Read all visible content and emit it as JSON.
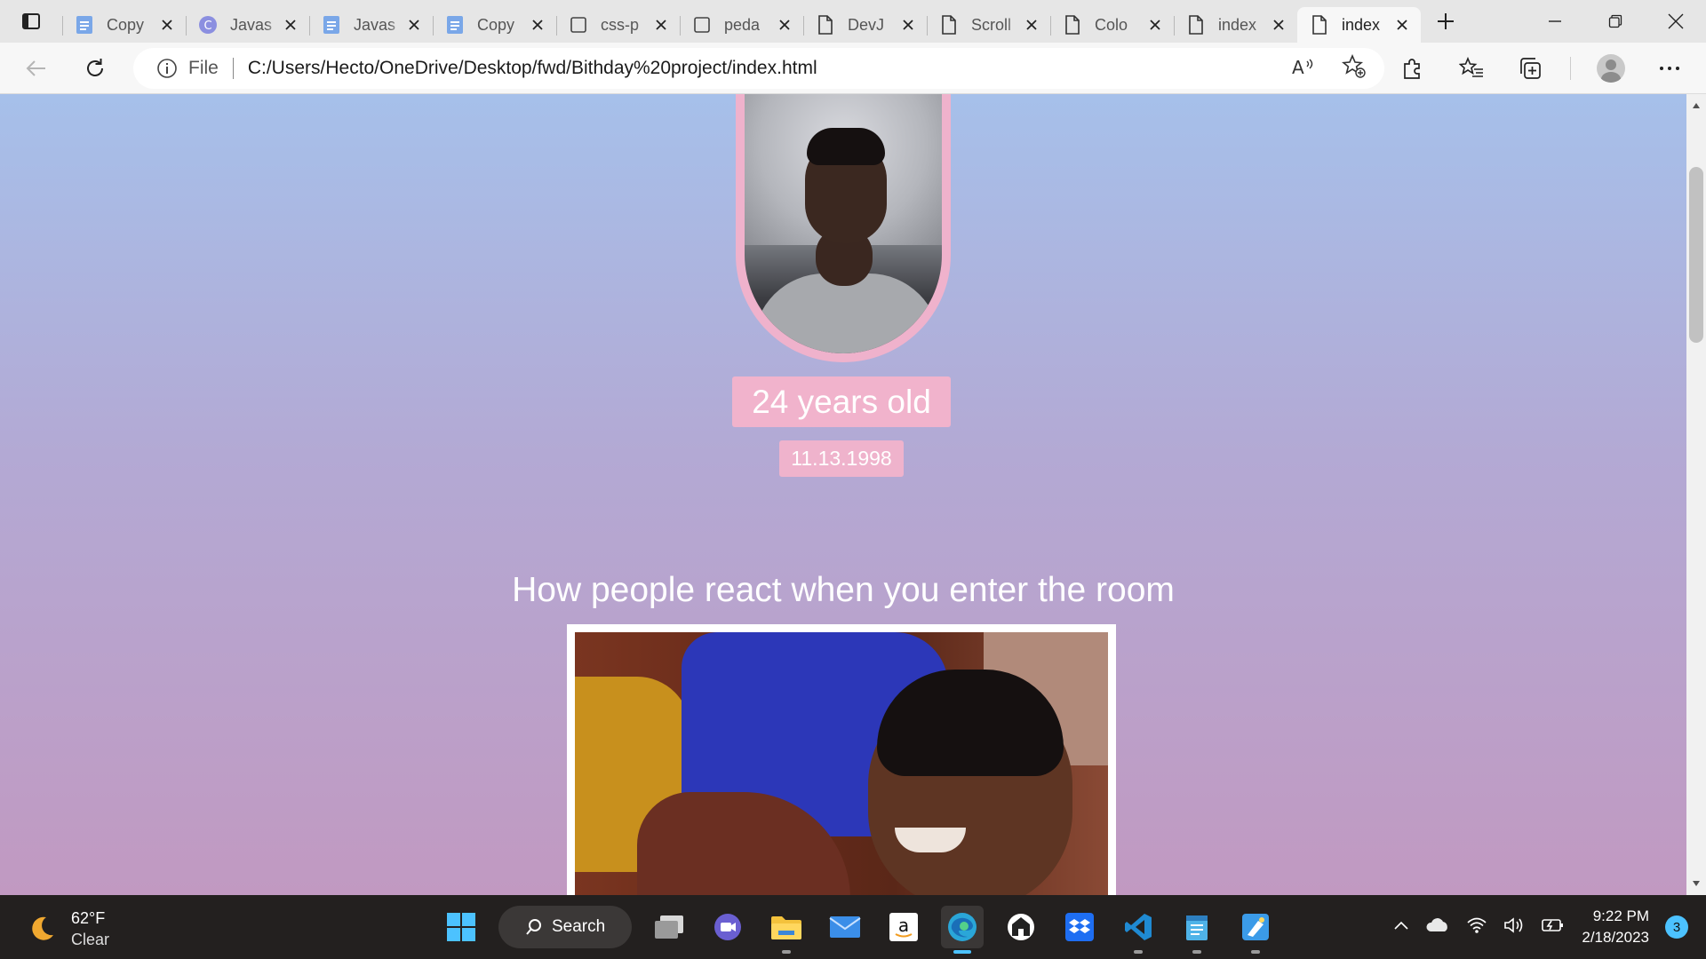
{
  "browser": {
    "tabs": [
      {
        "title": "Copy",
        "icon": "docs-icon",
        "active": false
      },
      {
        "title": "Javas",
        "icon": "canva-icon",
        "active": false
      },
      {
        "title": "Javas",
        "icon": "docs-icon",
        "active": false
      },
      {
        "title": "Copy",
        "icon": "docs-icon",
        "active": false
      },
      {
        "title": "css-p",
        "icon": "blank-page-icon",
        "active": false
      },
      {
        "title": "peda",
        "icon": "blank-page-icon",
        "active": false
      },
      {
        "title": "DevJ",
        "icon": "file-icon",
        "active": false
      },
      {
        "title": "Scroll",
        "icon": "file-icon",
        "active": false
      },
      {
        "title": "Colo",
        "icon": "file-icon",
        "active": false
      },
      {
        "title": "index",
        "icon": "file-icon",
        "active": false
      },
      {
        "title": "index",
        "icon": "file-icon",
        "active": true
      }
    ],
    "address": {
      "scheme_label": "File",
      "url": "C:/Users/Hecto/OneDrive/Desktop/fwd/Bithday%20project/index.html"
    }
  },
  "page": {
    "age_text": "24 years old",
    "birth_date": "11.13.1998",
    "section_heading": "How people react when you enter the room",
    "accent_pink": "#efb2cc",
    "gradient_top": "#a6c0ea",
    "gradient_bottom": "#c199c1"
  },
  "taskbar": {
    "weather": {
      "temp": "62°F",
      "condition": "Clear"
    },
    "search_label": "Search",
    "time": "9:22 PM",
    "date": "2/18/2023",
    "notification_count": "3"
  }
}
